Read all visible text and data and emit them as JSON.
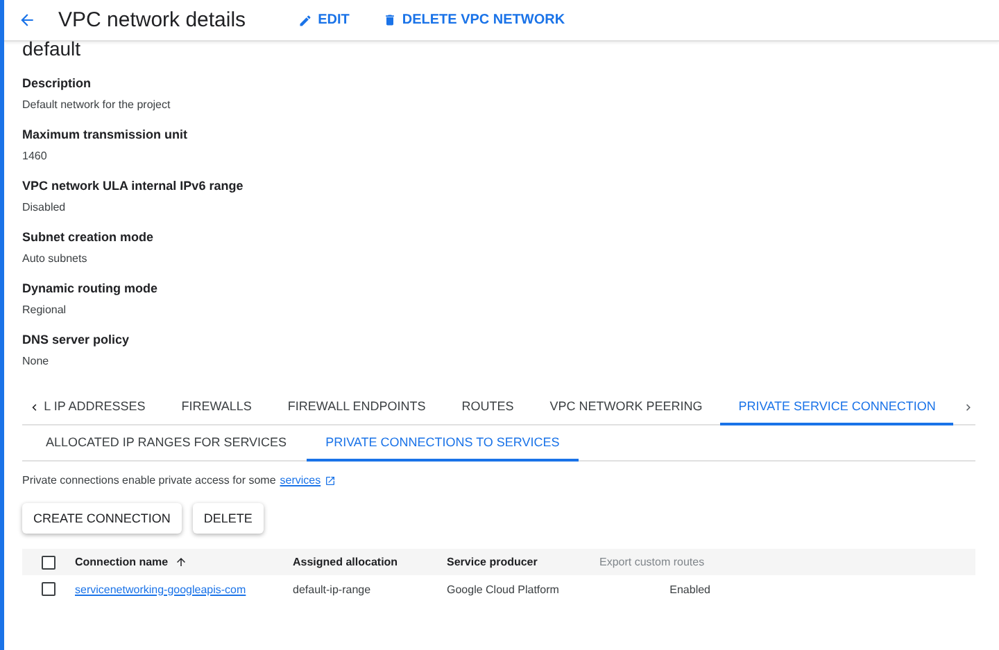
{
  "header": {
    "title": "VPC network details",
    "actions": [
      {
        "kind": "edit",
        "label": "EDIT"
      },
      {
        "kind": "delete",
        "label": "DELETE VPC NETWORK"
      }
    ]
  },
  "network_name": "default",
  "properties": [
    {
      "label": "Description",
      "value": "Default network for the project"
    },
    {
      "label": "Maximum transmission unit",
      "value": "1460"
    },
    {
      "label": "VPC network ULA internal IPv6 range",
      "value": "Disabled"
    },
    {
      "label": "Subnet creation mode",
      "value": "Auto subnets"
    },
    {
      "label": "Dynamic routing mode",
      "value": "Regional"
    },
    {
      "label": "DNS server policy",
      "value": "None"
    }
  ],
  "tabs": [
    {
      "label": "L IP ADDRESSES",
      "selected": false
    },
    {
      "label": "FIREWALLS",
      "selected": false
    },
    {
      "label": "FIREWALL ENDPOINTS",
      "selected": false
    },
    {
      "label": "ROUTES",
      "selected": false
    },
    {
      "label": "VPC NETWORK PEERING",
      "selected": false
    },
    {
      "label": "PRIVATE SERVICE CONNECTION",
      "selected": true
    }
  ],
  "subtabs": [
    {
      "label": "ALLOCATED IP RANGES FOR SERVICES",
      "selected": false
    },
    {
      "label": "PRIVATE CONNECTIONS TO SERVICES",
      "selected": true
    }
  ],
  "info": {
    "text": "Private connections enable private access for some",
    "link": "services"
  },
  "buttons": [
    "CREATE CONNECTION",
    "DELETE"
  ],
  "table": {
    "select_all_checked": false,
    "columns": [
      {
        "label": "Connection name",
        "sorted": true,
        "disabled": false
      },
      {
        "label": "Assigned allocation",
        "sorted": false,
        "disabled": false
      },
      {
        "label": "Service producer",
        "sorted": false,
        "disabled": false
      },
      {
        "label": "Export custom routes",
        "sorted": false,
        "disabled": true
      }
    ],
    "rows": [
      {
        "checked": false,
        "cells": [
          "servicenetworking-googleapis-com",
          "default-ip-range",
          "Google Cloud Platform",
          "Enabled"
        ]
      }
    ]
  }
}
